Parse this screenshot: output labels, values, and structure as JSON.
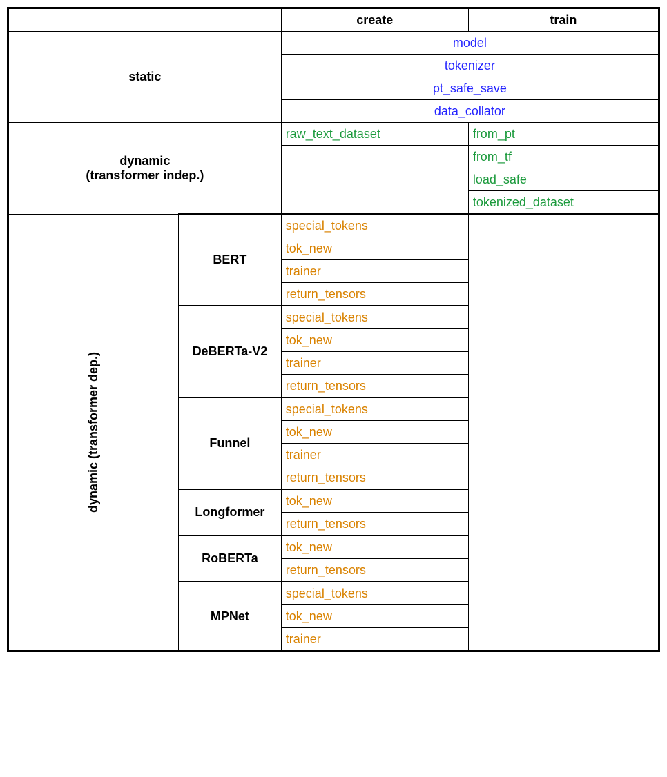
{
  "headers": {
    "create": "create",
    "train": "train"
  },
  "sections": {
    "static": {
      "label": "static",
      "items": [
        "model",
        "tokenizer",
        "pt_safe_save",
        "data_collator"
      ]
    },
    "dynamic_indep": {
      "label_line1": "dynamic",
      "label_line2": "(transformer indep.)",
      "create": [
        "raw_text_dataset"
      ],
      "train": [
        "from_pt",
        "from_tf",
        "load_safe",
        "tokenized_dataset"
      ]
    },
    "dynamic_dep": {
      "label": "dynamic (transformer dep.)",
      "models": [
        {
          "name": "BERT",
          "items": [
            "special_tokens",
            "tok_new",
            "trainer",
            "return_tensors"
          ]
        },
        {
          "name": "DeBERTa-V2",
          "items": [
            "special_tokens",
            "tok_new",
            "trainer",
            "return_tensors"
          ]
        },
        {
          "name": "Funnel",
          "items": [
            "special_tokens",
            "tok_new",
            "trainer",
            "return_tensors"
          ]
        },
        {
          "name": "Longformer",
          "items": [
            "tok_new",
            "return_tensors"
          ]
        },
        {
          "name": "RoBERTa",
          "items": [
            "tok_new",
            "return_tensors"
          ]
        },
        {
          "name": "MPNet",
          "items": [
            "special_tokens",
            "tok_new",
            "trainer"
          ]
        }
      ]
    }
  }
}
